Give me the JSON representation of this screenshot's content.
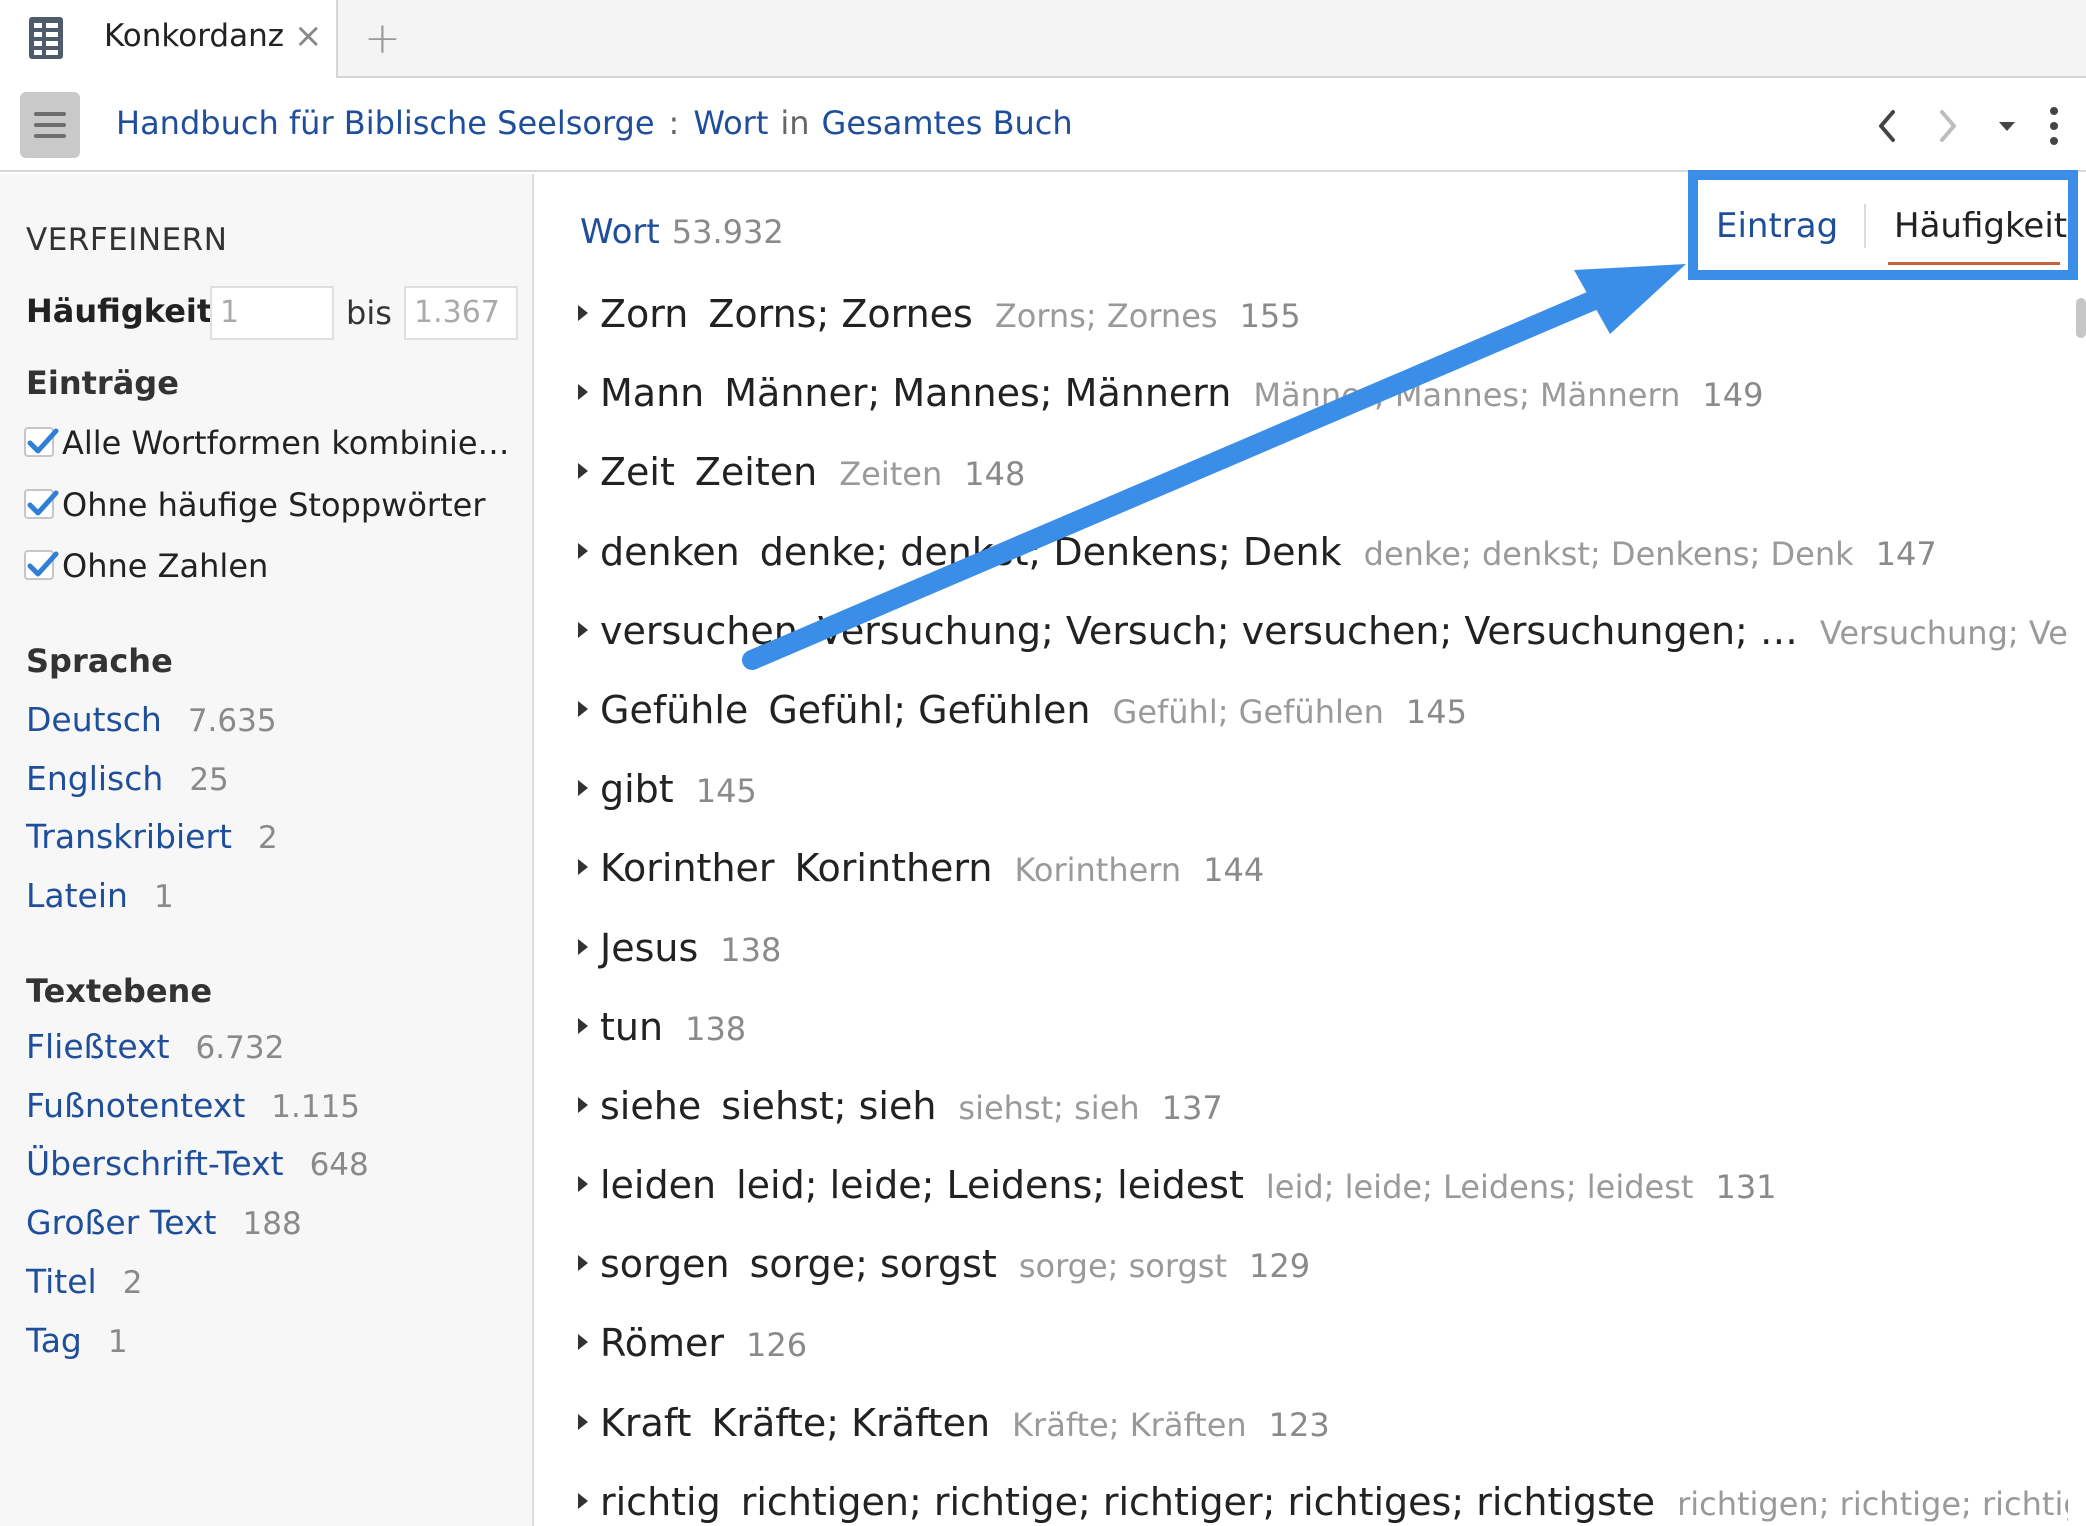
{
  "tab": {
    "label": "Konkordanz",
    "close_glyph": "×",
    "add_glyph": "+"
  },
  "toolbar": {
    "crumb_resource": "Handbuch für Biblische Seelsorge",
    "crumb_sep": ":",
    "crumb_type": "Wort",
    "crumb_in": "in",
    "crumb_scope": "Gesamtes Buch",
    "icons": [
      "menu-icon",
      "back-icon",
      "forward-icon",
      "dropdown-icon",
      "more-icon"
    ]
  },
  "sidebar": {
    "title": "VERFEINERN",
    "frequency": {
      "label": "Häufigkeit",
      "from_placeholder": "1",
      "to_label": "bis",
      "to_placeholder": "1.367"
    },
    "entries_head": "Einträge",
    "checks": [
      {
        "label": "Alle Wortformen kombinie…",
        "checked": true
      },
      {
        "label": "Ohne häufige Stoppwörter",
        "checked": true
      },
      {
        "label": "Ohne Zahlen",
        "checked": true
      }
    ],
    "language_head": "Sprache",
    "languages": [
      {
        "label": "Deutsch",
        "count": "7.635"
      },
      {
        "label": "Englisch",
        "count": "25"
      },
      {
        "label": "Transkribiert",
        "count": "2"
      },
      {
        "label": "Latein",
        "count": "1"
      }
    ],
    "textlevel_head": "Textebene",
    "textlevels": [
      {
        "label": "Fließtext",
        "count": "6.732"
      },
      {
        "label": "Fußnotentext",
        "count": "1.115"
      },
      {
        "label": "Überschrift-Text",
        "count": "648"
      },
      {
        "label": "Großer Text",
        "count": "188"
      },
      {
        "label": "Titel",
        "count": "2"
      },
      {
        "label": "Tag",
        "count": "1"
      }
    ]
  },
  "main": {
    "header_label": "Wort",
    "header_count": "53.932",
    "sort": {
      "entry": "Eintrag",
      "frequency": "Häufigkeit",
      "active": "frequency"
    },
    "entries": [
      {
        "word": "Zorn",
        "forms": "Zorns; Zornes",
        "forms_gray": "Zorns; Zornes",
        "count": "155"
      },
      {
        "word": "Mann",
        "forms": "Männer; Mannes; Männern",
        "forms_gray": "Männer; Mannes; Männern",
        "count": "149"
      },
      {
        "word": "Zeit",
        "forms": "Zeiten",
        "forms_gray": "Zeiten",
        "count": "148"
      },
      {
        "word": "denken",
        "forms": "denke; denkst; Denkens; Denk",
        "forms_gray": "denke; denkst; Denkens; Denk",
        "count": "147"
      },
      {
        "word": "versuchen",
        "forms": "Versuchung; Versuch; versuchen; Versuchungen; …",
        "forms_gray": "Versuchung; Versuch; versuchen; Versuchungen",
        "count": ""
      },
      {
        "word": "Gefühle",
        "forms": "Gefühl; Gefühlen",
        "forms_gray": "Gefühl; Gefühlen",
        "count": "145"
      },
      {
        "word": "gibt",
        "forms": "",
        "forms_gray": "",
        "count": "145"
      },
      {
        "word": "Korinther",
        "forms": "Korinthern",
        "forms_gray": "Korinthern",
        "count": "144"
      },
      {
        "word": "Jesus",
        "forms": "",
        "forms_gray": "",
        "count": "138"
      },
      {
        "word": "tun",
        "forms": "",
        "forms_gray": "",
        "count": "138"
      },
      {
        "word": "siehe",
        "forms": "siehst; sieh",
        "forms_gray": "siehst; sieh",
        "count": "137"
      },
      {
        "word": "leiden",
        "forms": "leid; leide; Leidens; leidest",
        "forms_gray": "leid; leide; Leidens; leidest",
        "count": "131"
      },
      {
        "word": "sorgen",
        "forms": "sorge; sorgst",
        "forms_gray": "sorge; sorgst",
        "count": "129"
      },
      {
        "word": "Römer",
        "forms": "",
        "forms_gray": "",
        "count": "126"
      },
      {
        "word": "Kraft",
        "forms": "Kräfte; Kräften",
        "forms_gray": "Kräfte; Kräften",
        "count": "123"
      },
      {
        "word": "richtig",
        "forms": "richtigen; richtige; richtiger; richtiges; richtigste",
        "forms_gray": "richtigen; richtige; richtiger; richtiges; richtigste",
        "count": ""
      }
    ]
  },
  "colors": {
    "link": "#1f4e9a",
    "highlight": "#3a8ee8",
    "underline": "#c8643c",
    "check": "#2f7fd6"
  }
}
